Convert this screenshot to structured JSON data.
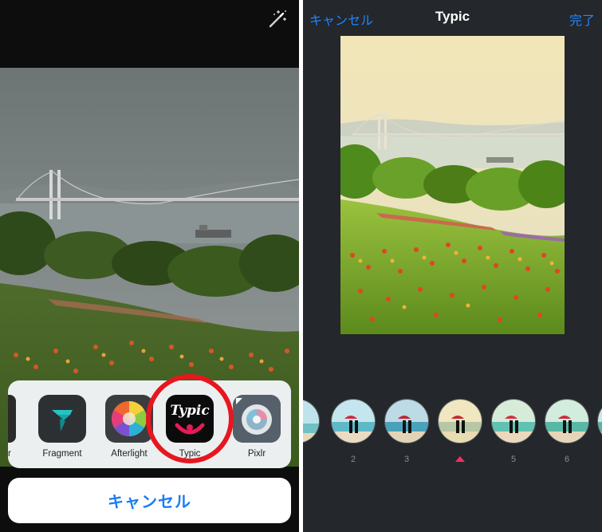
{
  "left_panel": {
    "magic_wand_icon": "magic-wand-icon",
    "share_sheet": {
      "partial_app_label": "r",
      "apps": [
        {
          "label": "Fragment",
          "icon": "fragment-icon"
        },
        {
          "label": "Afterlight",
          "icon": "afterlight-icon"
        },
        {
          "label": "Typic",
          "icon": "typic-icon",
          "tile_text": "Typic",
          "highlighted": true
        },
        {
          "label": "Pixlr",
          "icon": "pixlr-icon"
        }
      ]
    },
    "cancel_label": "キャンセル",
    "highlight_color": "#e8161e"
  },
  "right_panel": {
    "nav": {
      "cancel_label": "キャンセル",
      "title": "Typic",
      "done_label": "完了"
    },
    "filters": [
      {
        "number": ""
      },
      {
        "number": "2"
      },
      {
        "number": "3"
      },
      {
        "number": "",
        "selected": true
      },
      {
        "number": "5"
      },
      {
        "number": "6"
      }
    ],
    "accent_color": "#1f86ff",
    "selected_marker_color": "#ff2a68"
  }
}
